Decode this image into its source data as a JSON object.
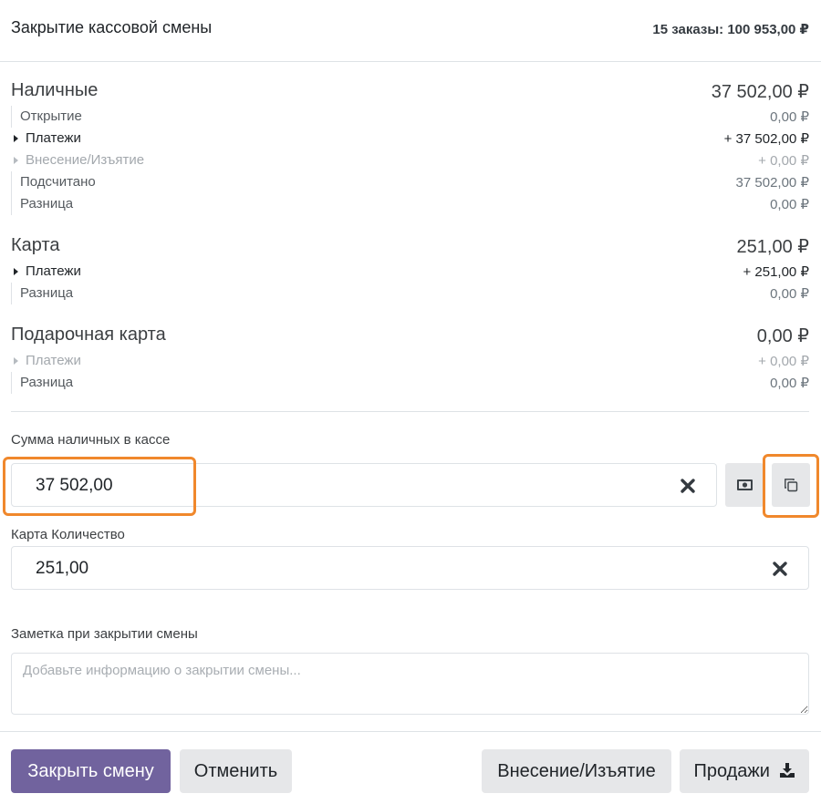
{
  "header": {
    "title": "Закрытие кассовой смены",
    "summary": "15 заказы: 100 953,00 ₽"
  },
  "cash": {
    "title": "Наличные",
    "total": "37 502,00 ₽",
    "rows": [
      {
        "label": "Открытие",
        "value": "0,00 ₽"
      },
      {
        "label": "Платежи",
        "value": "+ 37 502,00 ₽"
      },
      {
        "label": "Внесение/Изъятие",
        "value": "+ 0,00 ₽"
      },
      {
        "label": "Подсчитано",
        "value": "37 502,00 ₽"
      },
      {
        "label": "Разница",
        "value": "0,00 ₽"
      }
    ]
  },
  "card": {
    "title": "Карта",
    "total": "251,00 ₽",
    "rows": [
      {
        "label": "Платежи",
        "value": "+ 251,00 ₽"
      },
      {
        "label": "Разница",
        "value": "0,00 ₽"
      }
    ]
  },
  "gift": {
    "title": "Подарочная карта",
    "total": "0,00 ₽",
    "rows": [
      {
        "label": "Платежи",
        "value": "+ 0,00 ₽"
      },
      {
        "label": "Разница",
        "value": "0,00 ₽"
      }
    ]
  },
  "cash_input": {
    "label": "Сумма наличных в кассе",
    "value": "37 502,00"
  },
  "card_input": {
    "label": "Карта Количество",
    "value": "251,00"
  },
  "note": {
    "label": "Заметка при закрытии смены",
    "placeholder": "Добавьте информацию о закрытии смены..."
  },
  "buttons": {
    "close_shift": "Закрыть смену",
    "cancel": "Отменить",
    "cash_in_out": "Внесение/Изъятие",
    "sales": "Продажи"
  },
  "icons": {
    "clear": "close-icon",
    "money": "money-bill-icon",
    "copy": "copy-icon",
    "download": "download-icon"
  },
  "colors": {
    "primary": "#71639e",
    "highlight": "#f0882c",
    "secondary_bg": "#e6e7e9"
  }
}
